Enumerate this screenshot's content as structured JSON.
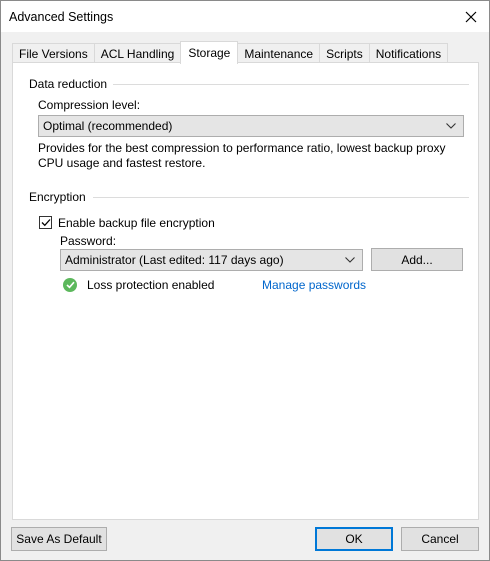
{
  "window": {
    "title": "Advanced Settings"
  },
  "tabs": [
    {
      "label": "File Versions"
    },
    {
      "label": "ACL Handling"
    },
    {
      "label": "Storage"
    },
    {
      "label": "Maintenance"
    },
    {
      "label": "Scripts"
    },
    {
      "label": "Notifications"
    }
  ],
  "active_tab": "Storage",
  "data_reduction": {
    "group_label": "Data reduction",
    "compression_label": "Compression level:",
    "compression_value": "Optimal (recommended)",
    "description": "Provides for the best compression to performance ratio, lowest backup proxy CPU usage and fastest restore."
  },
  "encryption": {
    "group_label": "Encryption",
    "enable_label": "Enable backup file encryption",
    "enable_checked": true,
    "password_label": "Password:",
    "password_value": "Administrator (Last edited: 117 days ago)",
    "add_button": "Add...",
    "status_text": "Loss protection enabled",
    "manage_link": "Manage passwords"
  },
  "footer": {
    "save_default": "Save As Default",
    "ok": "OK",
    "cancel": "Cancel"
  },
  "colors": {
    "link": "#0066cc",
    "status_ok": "#5cb85c",
    "focus": "#0078d7"
  },
  "icons": {
    "close": "close-icon",
    "dropdown": "chevron-down-icon",
    "check": "checkmark-icon",
    "status": "check-circle-icon"
  }
}
